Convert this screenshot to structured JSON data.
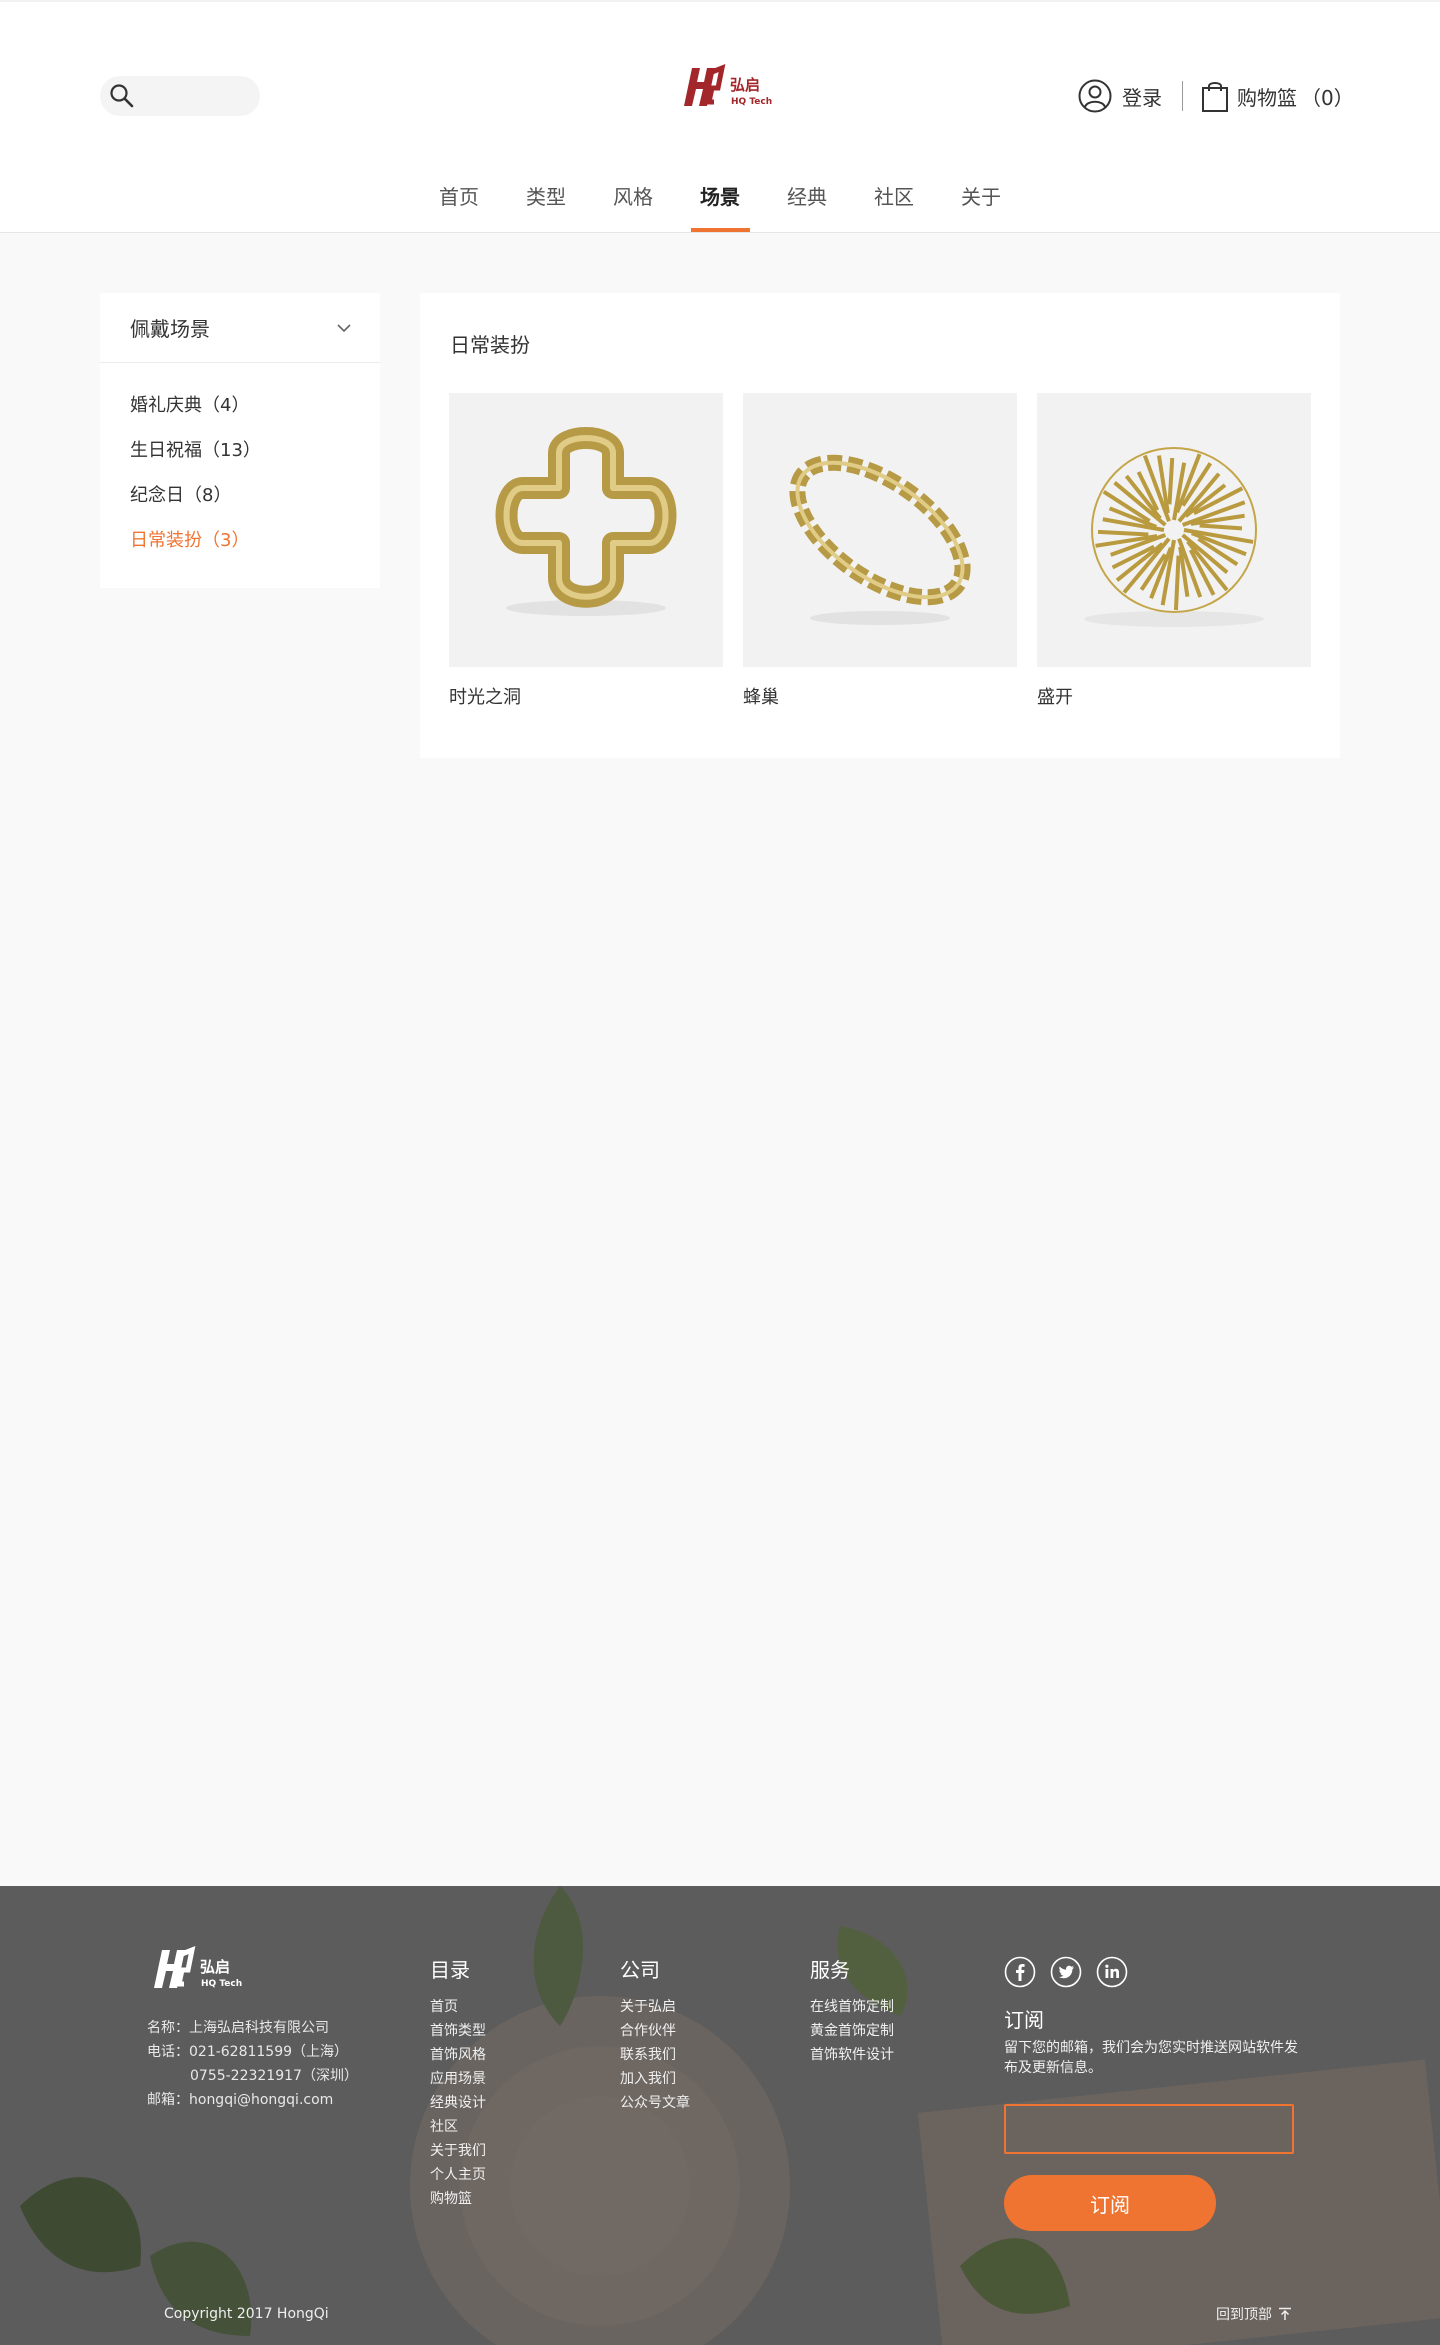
{
  "header": {
    "search_placeholder": "",
    "login_label": "登录",
    "cart_label": "购物篮",
    "cart_count": "（0）",
    "logo_text": "弘启 HQ Tech"
  },
  "nav": {
    "items": [
      "首页",
      "类型",
      "风格",
      "场景",
      "经典",
      "社区",
      "关于"
    ],
    "active": "场景"
  },
  "sidebar": {
    "title": "佩戴场景",
    "items": [
      {
        "label": "婚礼庆典（4）",
        "active": false
      },
      {
        "label": "生日祝福（13）",
        "active": false
      },
      {
        "label": "纪念日（8）",
        "active": false
      },
      {
        "label": "日常装扮（3）",
        "active": true
      }
    ]
  },
  "main": {
    "title": "日常装扮",
    "products": [
      {
        "name": "时光之洞",
        "image": "gold-cross-ring"
      },
      {
        "name": "蜂巢",
        "image": "gold-wave-ring"
      },
      {
        "name": "盛开",
        "image": "gold-burst-pendant"
      }
    ]
  },
  "footer": {
    "company": {
      "name": "名称：上海弘启科技有限公司",
      "phone1": "电话：021-62811599（上海）",
      "phone2": "0755-22321917（深圳）",
      "email": "邮箱：hongqi@hongqi.com"
    },
    "columns": [
      {
        "title": "目录",
        "links": [
          "首页",
          "首饰类型",
          "首饰风格",
          "应用场景",
          "经典设计",
          "社区",
          "关于我们",
          "个人主页",
          "购物篮"
        ]
      },
      {
        "title": "公司",
        "links": [
          "关于弘启",
          "合作伙伴",
          "联系我们",
          "加入我们",
          "公众号文章"
        ]
      },
      {
        "title": "服务",
        "links": [
          "在线首饰定制",
          "黄金首饰定制",
          "首饰软件设计"
        ]
      }
    ],
    "social": [
      "facebook-icon",
      "twitter-icon",
      "linkedin-icon"
    ],
    "subscribe": {
      "title": "订阅",
      "description": "留下您的邮箱，我们会为您实时推送网站软件发布及更新信息。",
      "input_value": "",
      "button_label": "订阅"
    },
    "copyright": "Copyright 2017 HongQi",
    "back_to_top": "回到顶部"
  },
  "colors": {
    "accent": "#f07431",
    "logo_red": "#a3262a",
    "gold": "#c9a94e",
    "footer_bg": "#5c5c5c"
  }
}
